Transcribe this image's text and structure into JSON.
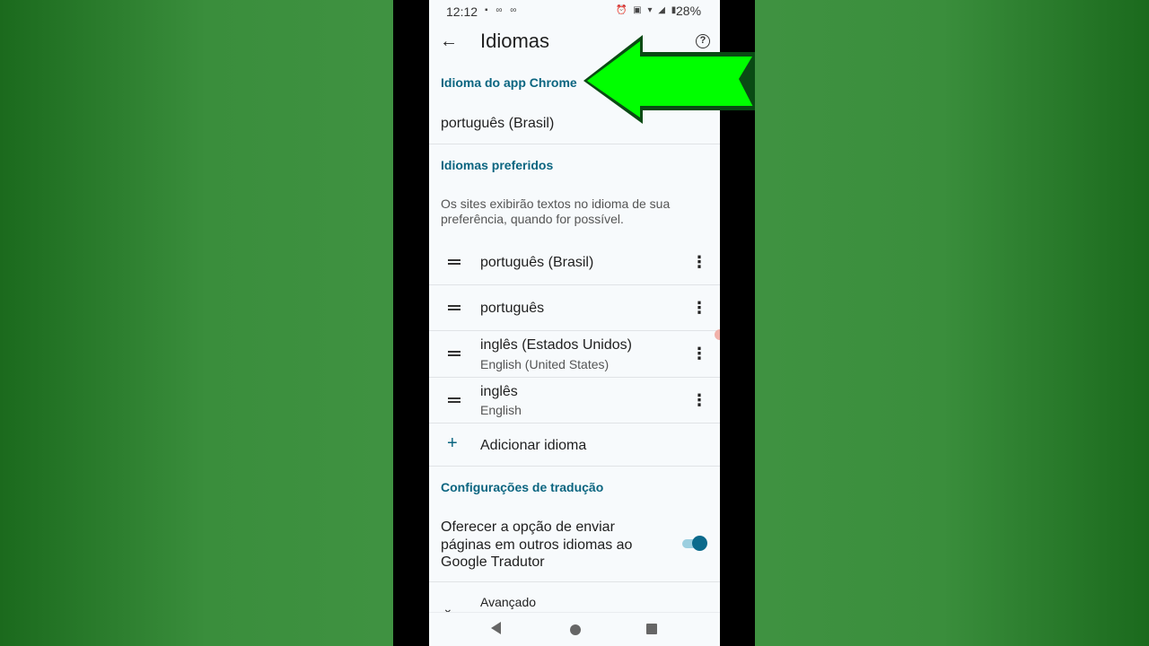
{
  "status_bar": {
    "time": "12:12",
    "battery": "28%",
    "left_icons": "▪ ∞ ∞",
    "right_icons": "⏰ ▣ ▾ ◢ ▮"
  },
  "app_bar": {
    "title": "Idiomas",
    "back_icon": "←",
    "help_icon": "?"
  },
  "chrome_language": {
    "section_title": "Idioma do app Chrome",
    "value": "português (Brasil)"
  },
  "preferred_languages": {
    "section_title": "Idiomas preferidos",
    "description": "Os sites exibirão textos no idioma de sua preferência, quando for possível.",
    "items": [
      {
        "name": "português (Brasil)",
        "subtitle": ""
      },
      {
        "name": "português",
        "subtitle": ""
      },
      {
        "name": "inglês (Estados Unidos)",
        "subtitle": "English (United States)"
      },
      {
        "name": "inglês",
        "subtitle": "English"
      }
    ],
    "more_icon": "⋮",
    "add_icon": "+",
    "add_label": "Adicionar idioma"
  },
  "translation": {
    "section_title": "Configurações de tradução",
    "offer_text": "Oferecer a opção de enviar páginas em outros idiomas ao Google Tradutor",
    "offer_enabled": true,
    "advanced_label": "Avançado",
    "advanced_icon": "⌄"
  },
  "colors": {
    "accent": "#0b6580",
    "arrow_fill": "#00ff00",
    "arrow_outline": "#0a4a14",
    "background_green": "#3f9241"
  }
}
